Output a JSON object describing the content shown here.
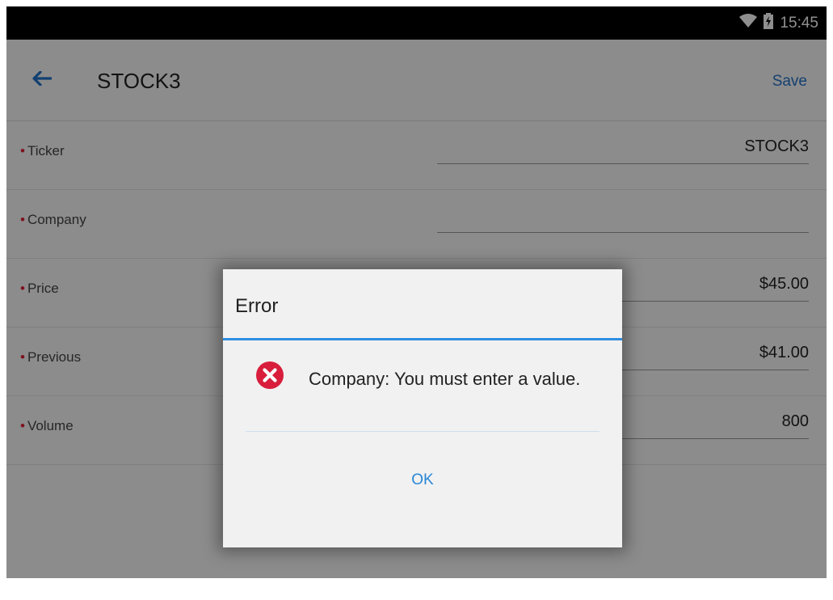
{
  "status_bar": {
    "time": "15:45",
    "icons": [
      "wifi-icon",
      "battery-charging-icon"
    ]
  },
  "app_bar": {
    "title": "STOCK3",
    "back_icon": "arrow-left-icon",
    "save_label": "Save",
    "accent_color": "#2272c9"
  },
  "form": {
    "required_marker": "•",
    "rows": [
      {
        "label": "Ticker",
        "value": "STOCK3"
      },
      {
        "label": "Company",
        "value": ""
      },
      {
        "label": "Price",
        "value": "$45.00"
      },
      {
        "label": "Previous",
        "value": "$41.00"
      },
      {
        "label": "Volume",
        "value": "800"
      }
    ]
  },
  "dialog": {
    "title": "Error",
    "message": "Company: You must enter a value.",
    "icon": "error-x-icon",
    "ok_label": "OK",
    "divider_color": "#2f8ee0",
    "error_color": "#d81e3c"
  }
}
